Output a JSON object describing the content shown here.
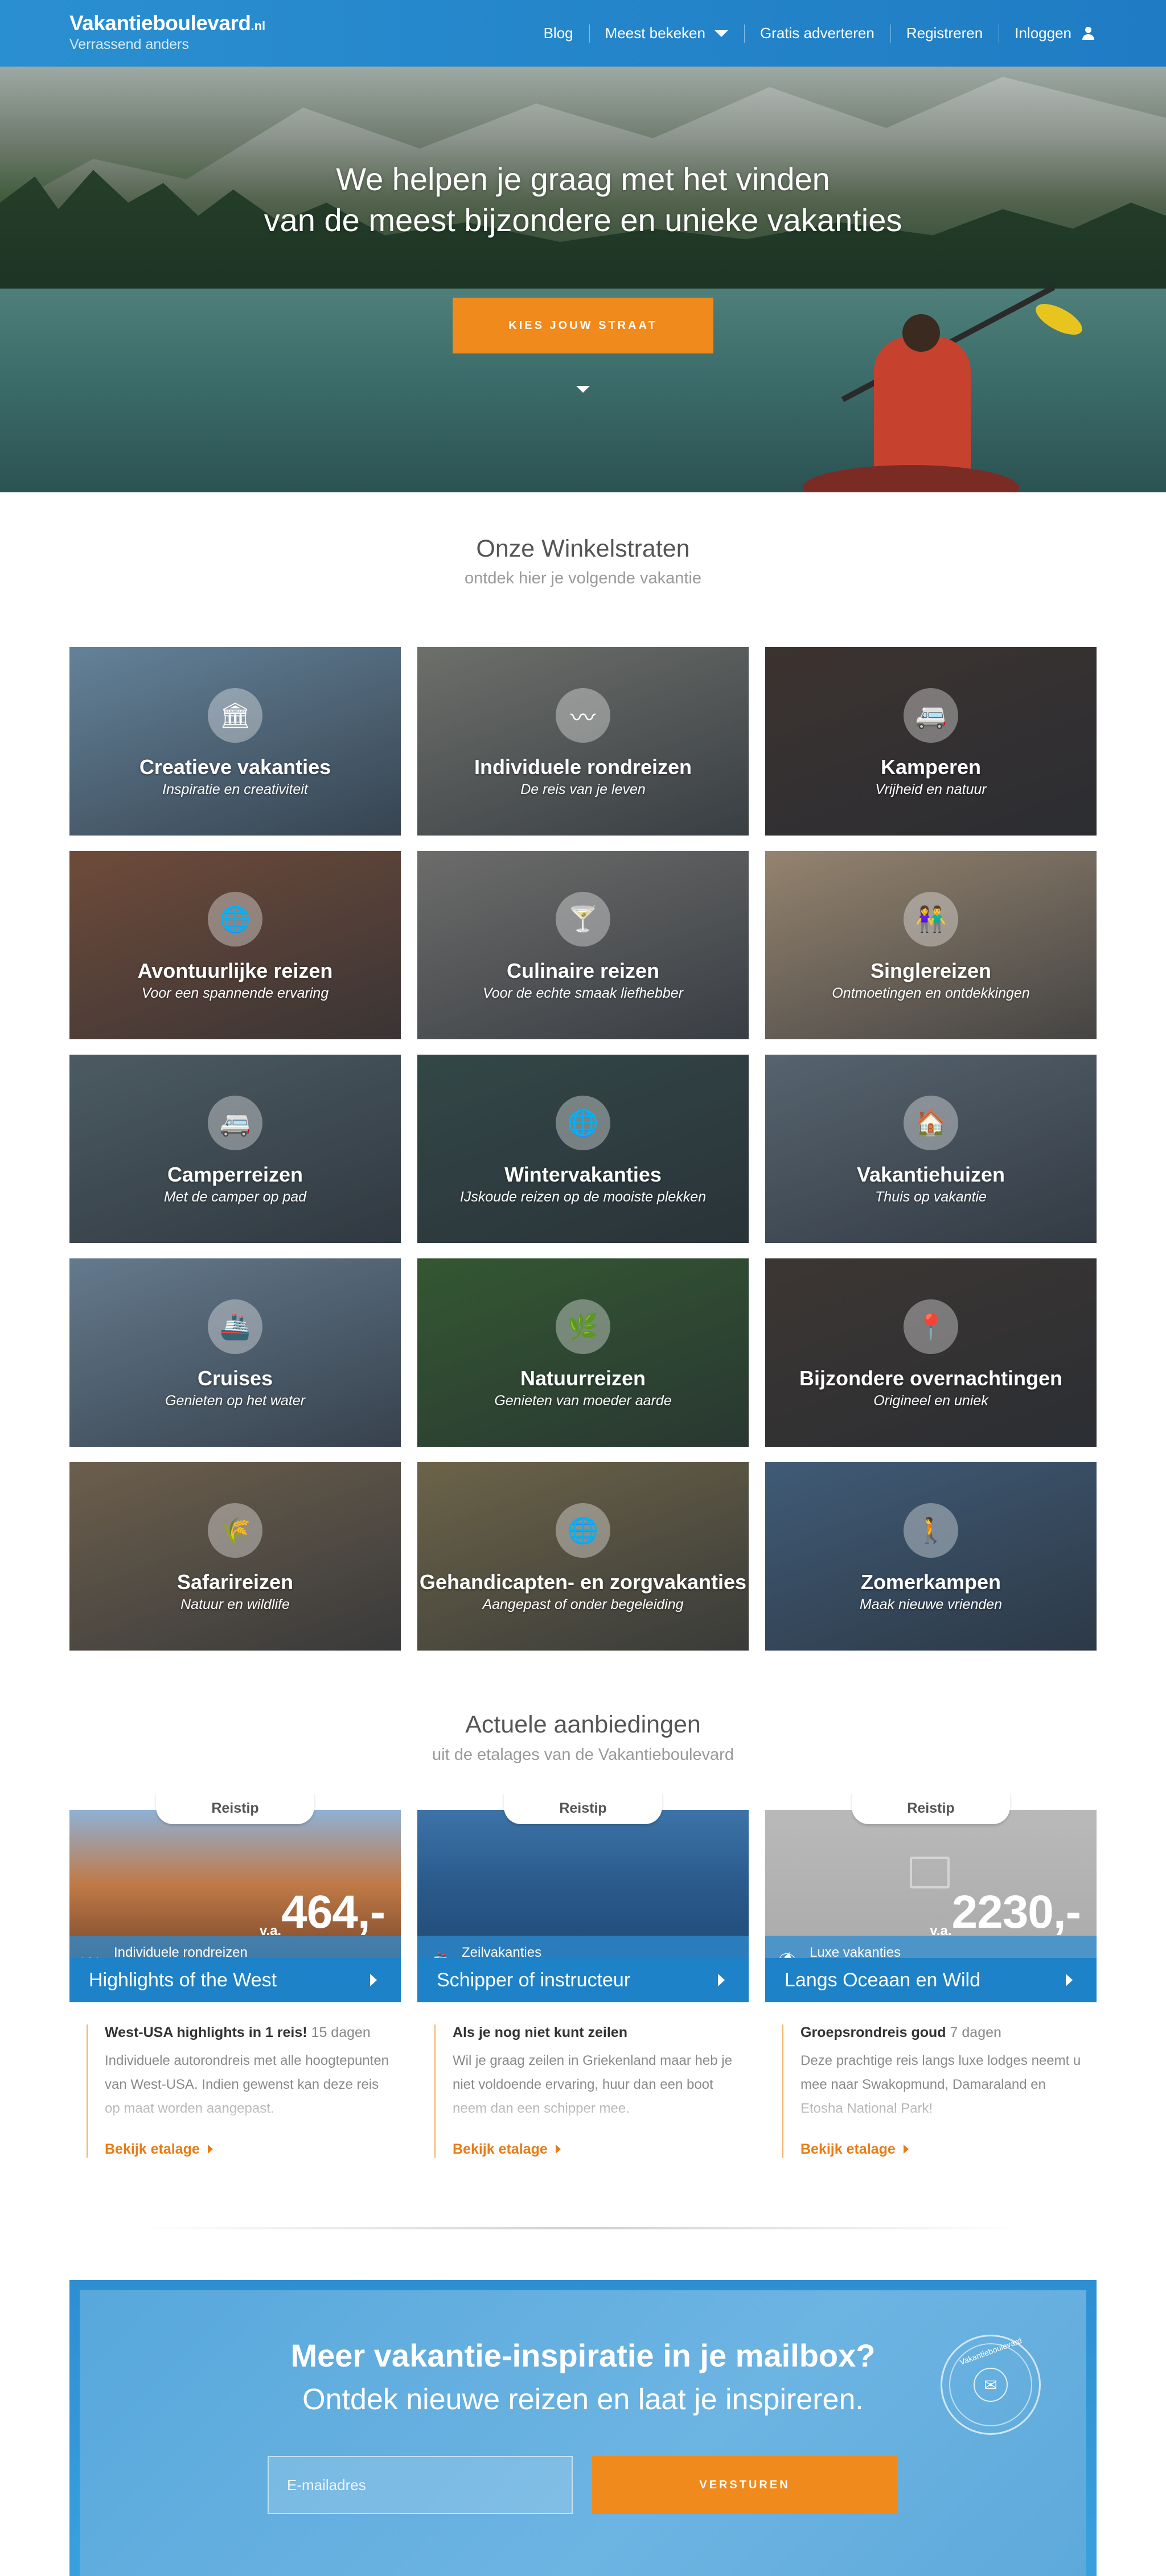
{
  "nav": {
    "brand": "Vakantieboulevard",
    "brand_tld": ".nl",
    "tagline": "Verrassend anders",
    "links": {
      "blog": "Blog",
      "most_viewed": "Meest bekeken",
      "advertise": "Gratis adverteren",
      "register": "Registreren",
      "login": "Inloggen"
    }
  },
  "hero": {
    "line1": "We helpen je graag met het vinden",
    "line2": "van de meest bijzondere en unieke vakanties",
    "cta": "KIES JOUW STRAAT"
  },
  "streets": {
    "title": "Onze Winkelstraten",
    "subtitle": "ontdek hier je volgende vakantie",
    "items": [
      {
        "title": "Creatieve vakanties",
        "subtitle": "Inspiratie en creativiteit",
        "icon": "museum-icon",
        "color": "#7fa3be"
      },
      {
        "title": "Individuele rondreizen",
        "subtitle": "De reis van je leven",
        "icon": "route-icon",
        "color": "#8b8a80"
      },
      {
        "title": "Kamperen",
        "subtitle": "Vrijheid en natuur",
        "icon": "caravan-icon",
        "color": "#4a3a32"
      },
      {
        "title": "Avontuurlijke reizen",
        "subtitle": "Voor een spannende ervaring",
        "icon": "globe-icon",
        "color": "#8d5a3f"
      },
      {
        "title": "Culinaire reizen",
        "subtitle": "Voor de echte smaak liefhebber",
        "icon": "cocktail-icon",
        "color": "#8a8680"
      },
      {
        "title": "Singlereizen",
        "subtitle": "Ontmoetingen en ontdekkingen",
        "icon": "couple-icon",
        "color": "#c0a585"
      },
      {
        "title": "Camperreizen",
        "subtitle": "Met de camper op pad",
        "icon": "camper-icon",
        "color": "#5f6f75"
      },
      {
        "title": "Wintervakanties",
        "subtitle": "IJskoude reizen op de mooiste plekken",
        "icon": "globe-icon",
        "color": "#3f5550"
      },
      {
        "title": "Vakantiehuizen",
        "subtitle": "Thuis op vakantie",
        "icon": "house-icon",
        "color": "#6d7a85"
      },
      {
        "title": "Cruises",
        "subtitle": "Genieten op het water",
        "icon": "ship-icon",
        "color": "#7f98ad"
      },
      {
        "title": "Natuurreizen",
        "subtitle": "Genieten van moeder aarde",
        "icon": "nature-icon",
        "color": "#3f6a33"
      },
      {
        "title": "Bijzondere overnachtingen",
        "subtitle": "Origineel en uniek",
        "icon": "pin-icon",
        "color": "#4a3e36"
      },
      {
        "title": "Safarireizen",
        "subtitle": "Natuur en wildlife",
        "icon": "grass-icon",
        "color": "#8a7458"
      },
      {
        "title": "Gehandicapten- en zorgvakanties",
        "subtitle": "Aangepast of onder begeleiding",
        "icon": "globe-icon",
        "color": "#8a7a52"
      },
      {
        "title": "Zomerkampen",
        "subtitle": "Maak nieuwe vrienden",
        "icon": "hiker-icon",
        "color": "#4f6f8f"
      }
    ]
  },
  "offers": {
    "title": "Actuele aanbiedingen",
    "subtitle": "uit de etalages van de Vakantieboulevard",
    "items": [
      {
        "tab": "Reistip",
        "category": "Individuele rondreizen",
        "cat_icon": "route-icon",
        "price_prefix": "v.a.",
        "price": "464,-",
        "title": "Highlights of the West",
        "lead_bold": "West-USA highlights in 1 reis!",
        "lead_extra": "15 dagen",
        "desc": "Individuele autorondreis met alle hoogtepunten van West-USA. Indien gewenst kan deze reis op maat worden aangepast.",
        "more": "Bekijk etalage",
        "img": [
          "#8fb1d6",
          "#c07a47",
          "#6b3d26"
        ]
      },
      {
        "tab": "Reistip",
        "category": "Zeilvakanties",
        "cat_icon": "ship-icon",
        "price_prefix": "",
        "price": "",
        "title": "Schipper of instructeur",
        "lead_bold": "Als je nog niet kunt zeilen",
        "lead_extra": "",
        "desc": "Wil je graag zeilen in Griekenland maar heb je niet voldoende ervaring, huur dan een boot neem dan een schipper mee.",
        "more": "Bekijk etalage",
        "img": [
          "#3d73a8",
          "#2a5a8c",
          "#1e4770"
        ]
      },
      {
        "tab": "Reistip",
        "category": "Luxe vakanties",
        "cat_icon": "beach-icon",
        "price_prefix": "v.a.",
        "price": "2230,-",
        "title": "Langs Oceaan en Wild",
        "lead_bold": "Groepsrondreis goud",
        "lead_extra": "7 dagen",
        "desc": "Deze prachtige reis langs luxe lodges neemt u mee naar Swakopmund, Damaraland en Etosha National Park!",
        "more": "Bekijk etalage",
        "img": [
          "#b9b9b9",
          "#b2b2b2",
          "#a9a9a9"
        ]
      }
    ]
  },
  "newsletter": {
    "title": "Meer vakantie-inspiratie in je mailbox?",
    "subtitle": "Ontdek nieuwe reizen en laat je inspireren.",
    "placeholder": "E-mailadres",
    "button": "VERSTUREN",
    "seal_text": "Vakantieboulevard"
  }
}
